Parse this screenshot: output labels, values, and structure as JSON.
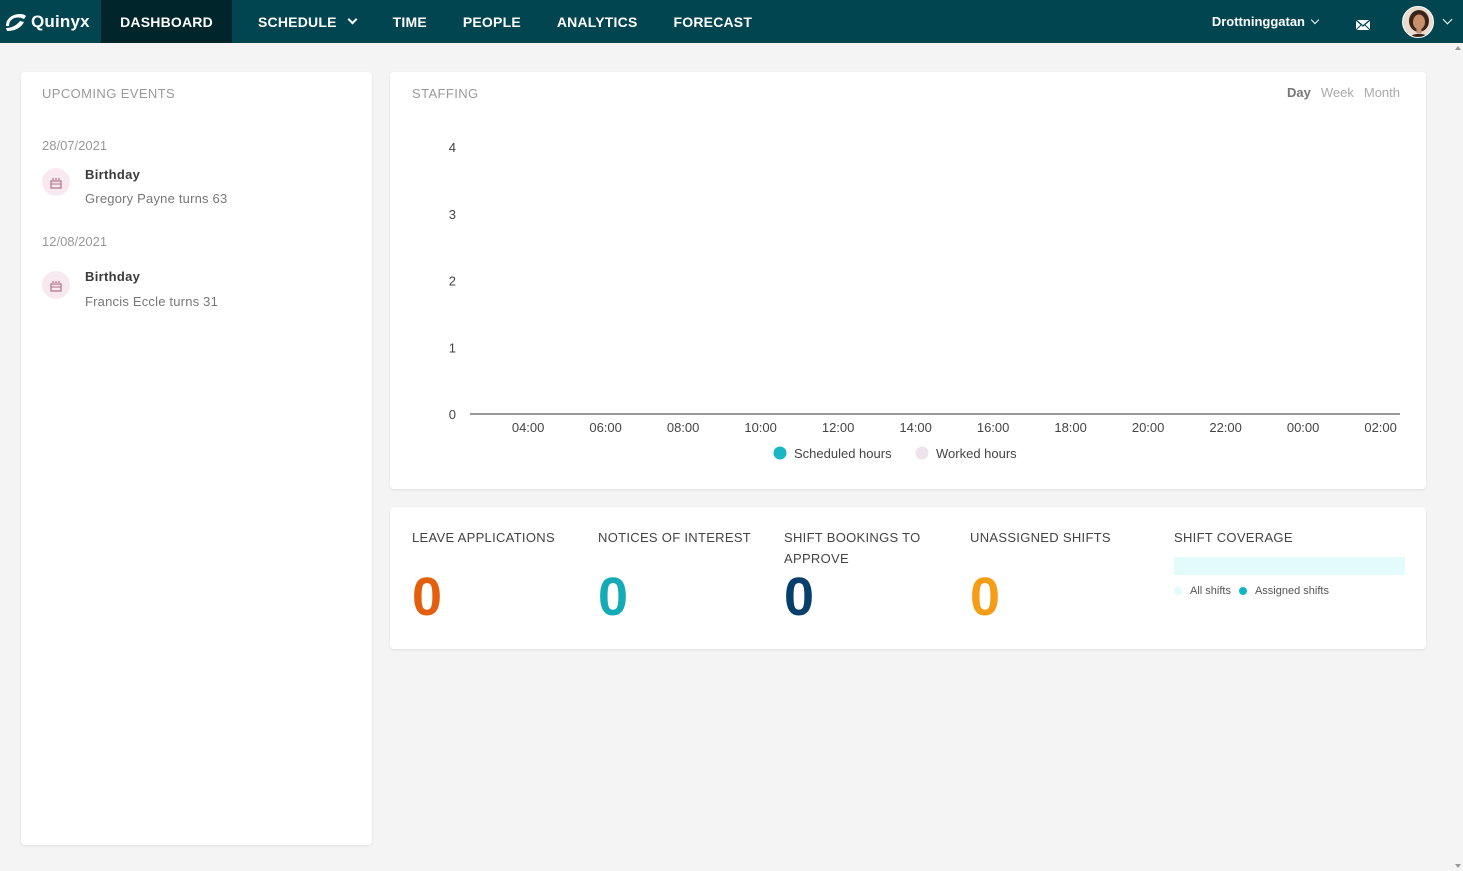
{
  "app": {
    "brand": "Quinyx"
  },
  "nav": {
    "items": [
      {
        "label": "DASHBOARD",
        "active": true
      },
      {
        "label": "SCHEDULE",
        "dropdown": true
      },
      {
        "label": "TIME"
      },
      {
        "label": "PEOPLE"
      },
      {
        "label": "ANALYTICS"
      },
      {
        "label": "FORECAST"
      }
    ],
    "location": "Drottninggatan",
    "mail_icon": "mail-icon",
    "avatar_icon": "user-avatar"
  },
  "events": {
    "title": "UPCOMING EVENTS",
    "groups": [
      {
        "date": "28/07/2021",
        "title": "Birthday",
        "desc": "Gregory Payne turns 63",
        "icon": "cake-icon"
      },
      {
        "date": "12/08/2021",
        "title": "Birthday",
        "desc": "Francis Eccle turns 31",
        "icon": "cake-icon"
      }
    ]
  },
  "staffing": {
    "title": "STAFFING",
    "periods": [
      "Day",
      "Week",
      "Month"
    ],
    "selected_period": "Day"
  },
  "chart_data": {
    "type": "line",
    "title": "STAFFING",
    "y_ticks": [
      "0",
      "1",
      "2",
      "3",
      "4"
    ],
    "ylim": [
      0,
      4
    ],
    "x": [
      "04:00",
      "06:00",
      "08:00",
      "10:00",
      "12:00",
      "14:00",
      "16:00",
      "18:00",
      "20:00",
      "22:00",
      "00:00",
      "02:00"
    ],
    "series": [
      {
        "name": "Scheduled hours",
        "color": "#1bb6c4",
        "values": []
      },
      {
        "name": "Worked hours",
        "color": "#efe3eb",
        "values": []
      }
    ],
    "legend": "bottom-center",
    "grid": false
  },
  "stats": {
    "leave": {
      "label": "LEAVE APPLICATIONS",
      "value": "0",
      "color": "#e35f0e"
    },
    "notices": {
      "label": "NOTICES OF INTEREST",
      "value": "0",
      "color": "#14aab6"
    },
    "bookings": {
      "label": "SHIFT BOOKINGS TO APPROVE",
      "value": "0",
      "color": "#063e6c"
    },
    "unassigned": {
      "label": "UNASSIGNED SHIFTS",
      "value": "0",
      "color": "#f59d17"
    },
    "coverage": {
      "label": "SHIFT COVERAGE",
      "legend": [
        {
          "name": "All shifts",
          "color": "#e3fbfb"
        },
        {
          "name": "Assigned shifts",
          "color": "#12b6c3"
        }
      ]
    }
  }
}
